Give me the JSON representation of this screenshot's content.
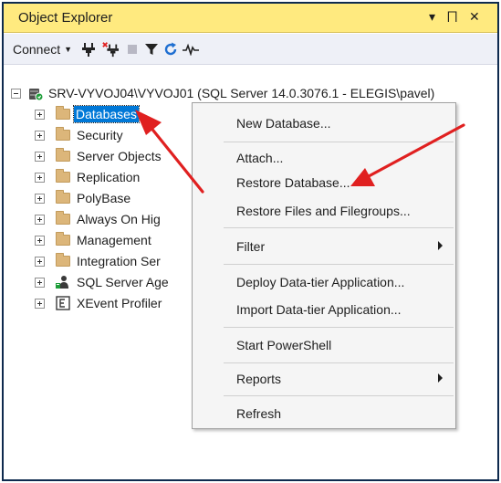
{
  "window": {
    "title": "Object Explorer",
    "controls": {
      "dropdown": "▾",
      "pin": "⨅",
      "close": "✕"
    }
  },
  "toolbar": {
    "connect_label": "Connect",
    "icons": [
      "connect-plug-icon",
      "disconnect-icon",
      "stop-icon",
      "filter-icon",
      "refresh-icon",
      "activity-monitor-icon"
    ]
  },
  "tree": {
    "server_label": "SRV-VYVOJ04\\VYVOJ01 (SQL Server 14.0.3076.1 - ELEGIS\\pavel)",
    "items": [
      {
        "label": "Databases",
        "icon": "folder-icon"
      },
      {
        "label": "Security",
        "icon": "folder-icon"
      },
      {
        "label": "Server Objects",
        "icon": "folder-icon"
      },
      {
        "label": "Replication",
        "icon": "folder-icon"
      },
      {
        "label": "PolyBase",
        "icon": "folder-icon"
      },
      {
        "label": "Always On Hig",
        "icon": "folder-icon"
      },
      {
        "label": "Management",
        "icon": "folder-icon"
      },
      {
        "label": "Integration Ser",
        "icon": "folder-icon"
      },
      {
        "label": "SQL Server Age",
        "icon": "sql-agent-icon"
      },
      {
        "label": "XEvent Profiler",
        "icon": "xevent-profiler-icon"
      }
    ]
  },
  "context_menu": {
    "items": [
      {
        "label": "New Database..."
      },
      {
        "label": "Attach..."
      },
      {
        "label": "Restore Database..."
      },
      {
        "label": "Restore Files and Filegroups..."
      },
      {
        "label": "Filter",
        "has_submenu": true
      },
      {
        "label": "Deploy Data-tier Application..."
      },
      {
        "label": "Import Data-tier Application..."
      },
      {
        "label": "Start PowerShell"
      },
      {
        "label": "Reports",
        "has_submenu": true
      },
      {
        "label": "Refresh"
      }
    ]
  },
  "colors": {
    "titlebar": "#ffea7f",
    "selection": "#0078d7",
    "annotation_arrow": "#e02020"
  }
}
